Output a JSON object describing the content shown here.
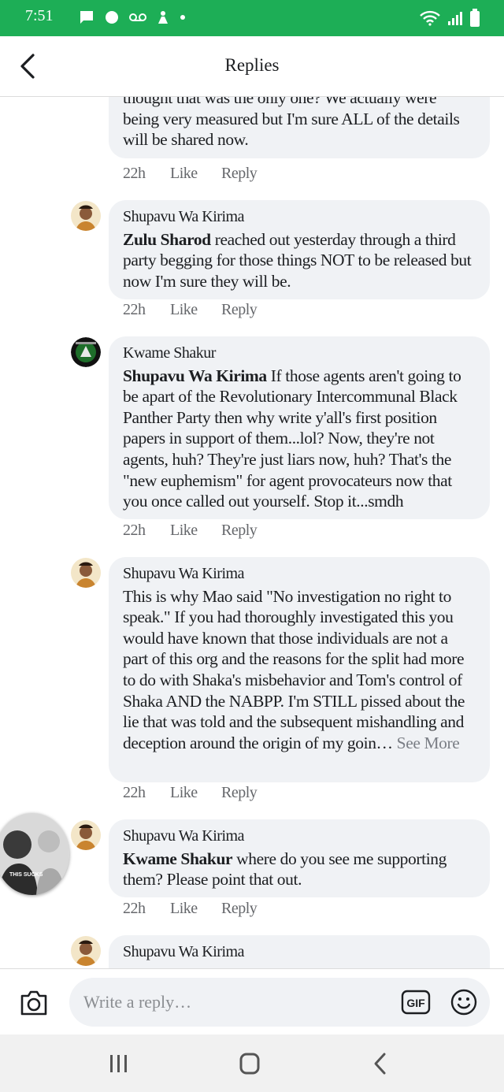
{
  "status": {
    "time": "7:51"
  },
  "appbar": {
    "title": "Replies"
  },
  "comments": [
    {
      "author": "",
      "mention": "",
      "text": "thought that was the only one? We actually were being very measured but I'm sure ALL of the details will be shared now.",
      "time": "22h",
      "like": "Like",
      "reply": "Reply"
    },
    {
      "author": "Shupavu Wa Kirima",
      "mention": "Zulu Sharod",
      "text": " reached out yesterday through a third party begging for those things NOT to be released but now I'm sure they will be.",
      "time": "22h",
      "like": "Like",
      "reply": "Reply"
    },
    {
      "author": "Kwame Shakur",
      "mention": "Shupavu Wa Kirima",
      "text": " If those agents aren't going to be apart of the Revolutionary Intercommunal Black Panther Party then why write y'all's first position papers in support of them...lol? Now, they're not agents, huh? They're just liars now, huh? That's the \"new euphemism\" for agent provocateurs now that you once called out yourself. Stop it...smdh",
      "time": "22h",
      "like": "Like",
      "reply": "Reply"
    },
    {
      "author": "Shupavu Wa Kirima",
      "mention": "",
      "text": "This is why Mao said \"No investigation no right to speak.\" If you had thoroughly investigated this you would have known that those individuals are not a part of this org and the reasons for the split had more to do with Shaka's misbehavior and Tom's control of Shaka AND the NABPP. I'm STILL pissed about the lie that was told and the subsequent mishandling and deception around the origin of my goin…",
      "see_more": " See More",
      "time": "22h",
      "like": "Like",
      "reply": "Reply"
    },
    {
      "author": "Shupavu Wa Kirima",
      "mention": "Kwame Shakur",
      "text": " where do you see me supporting them? Please point that out.",
      "time": "22h",
      "like": "Like",
      "reply": "Reply"
    },
    {
      "author": "Shupavu Wa Kirima",
      "mention": "",
      "text": ""
    }
  ],
  "floating_head_label": "THIS SUCKS",
  "composer": {
    "placeholder": "Write a reply…",
    "gif_label": "GIF"
  },
  "colors": {
    "status_bar": "#1dae56",
    "bubble": "#f0f2f5",
    "meta": "#65676b"
  }
}
